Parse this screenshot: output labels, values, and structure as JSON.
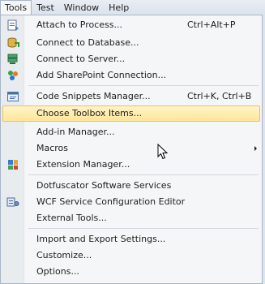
{
  "menubar": {
    "tabs": [
      {
        "label": "Tools"
      },
      {
        "label": "Test"
      },
      {
        "label": "Window"
      },
      {
        "label": "Help"
      }
    ]
  },
  "menu": {
    "items": [
      {
        "label": "Attach to Process...",
        "shortcut": "Ctrl+Alt+P",
        "icon": "attach-process-icon"
      },
      {
        "label": "Connect to Database...",
        "shortcut": "",
        "icon": "database-connect-icon"
      },
      {
        "label": "Connect to Server...",
        "shortcut": "",
        "icon": "server-connect-icon"
      },
      {
        "label": "Add SharePoint Connection...",
        "shortcut": "",
        "icon": "sharepoint-icon"
      },
      {
        "label": "Code Snippets Manager...",
        "shortcut": "Ctrl+K, Ctrl+B",
        "icon": "code-snippets-icon"
      },
      {
        "label": "Choose Toolbox Items...",
        "shortcut": "",
        "icon": ""
      },
      {
        "label": "Add-in Manager...",
        "shortcut": "",
        "icon": ""
      },
      {
        "label": "Macros",
        "shortcut": "",
        "icon": ""
      },
      {
        "label": "Extension Manager...",
        "shortcut": "",
        "icon": "extension-manager-icon"
      },
      {
        "label": "Dotfuscator Software Services",
        "shortcut": "",
        "icon": ""
      },
      {
        "label": "WCF Service Configuration Editor",
        "shortcut": "",
        "icon": "wcf-editor-icon"
      },
      {
        "label": "External Tools...",
        "shortcut": "",
        "icon": ""
      },
      {
        "label": "Import and Export Settings...",
        "shortcut": "",
        "icon": ""
      },
      {
        "label": "Customize...",
        "shortcut": "",
        "icon": ""
      },
      {
        "label": "Options...",
        "shortcut": "",
        "icon": ""
      }
    ]
  },
  "colors": {
    "highlight": "#ffe69a",
    "highlight_border": "#e5c365",
    "menu_bg": "#f5f6f7",
    "gutter": "#e9ecee"
  }
}
